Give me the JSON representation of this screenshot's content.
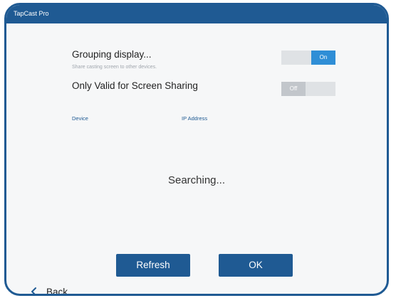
{
  "window": {
    "title": "TapCast Pro"
  },
  "grouping": {
    "label": "Grouping display...",
    "description": "Share casting screen to other devices.",
    "toggle": {
      "state_label": "On",
      "enabled": true
    }
  },
  "screen_sharing": {
    "label": "Only Valid for Screen Sharing",
    "toggle": {
      "state_label": "Off",
      "enabled": false
    }
  },
  "table": {
    "columns": [
      "Device",
      "IP Address"
    ]
  },
  "status_text": "Searching...",
  "buttons": {
    "refresh": "Refresh",
    "ok": "OK"
  },
  "back": {
    "label": "Back",
    "icon": "chevron-left-icon"
  },
  "colors": {
    "primary": "#1f5a93",
    "toggle_on": "#2f8ed6",
    "toggle_off": "#c2c6cb"
  }
}
